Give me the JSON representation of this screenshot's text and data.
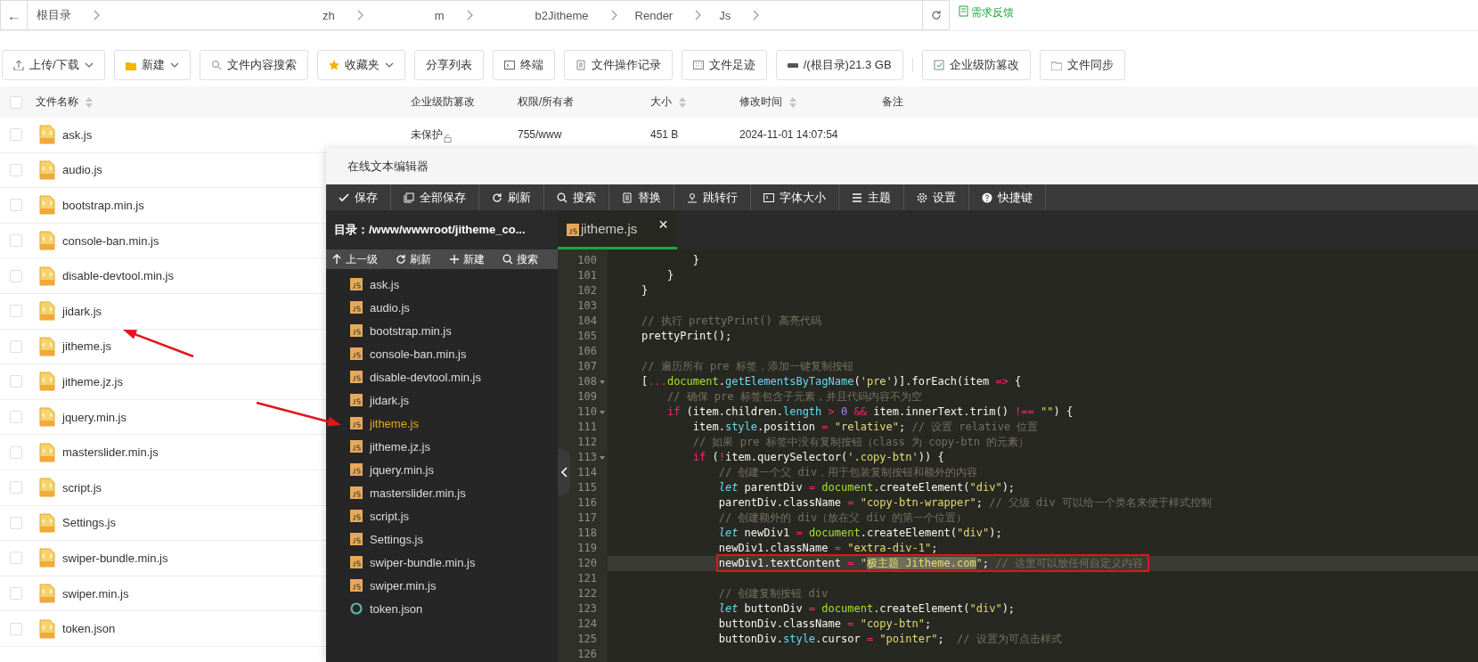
{
  "address_bar": {
    "back": "←",
    "segments": [
      "根目录",
      "zh",
      "m",
      "b2Jitheme",
      "Render",
      "Js"
    ],
    "feedback": "需求反馈"
  },
  "toolbar": [
    {
      "label": "上传/下载",
      "dropdown": true
    },
    {
      "label": "新建",
      "dropdown": true
    },
    {
      "label": "文件内容搜索",
      "dropdown": false
    },
    {
      "label": "收藏夹",
      "dropdown": true
    },
    {
      "label": "分享列表",
      "dropdown": false
    },
    {
      "label": "终端",
      "dropdown": false
    },
    {
      "label": "文件操作记录",
      "dropdown": false
    },
    {
      "label": "文件足迹",
      "dropdown": false
    },
    {
      "label": "/(根目录)21.3 GB",
      "dropdown": false
    },
    {
      "label": "企业级防篡改",
      "dropdown": false
    },
    {
      "label": "文件同步",
      "dropdown": false
    }
  ],
  "table": {
    "all_checked": false,
    "columns": [
      {
        "label": "文件名称",
        "sortable": true
      },
      {
        "label": "企业级防篡改",
        "sortable": false
      },
      {
        "label": "权限/所有者",
        "sortable": false
      },
      {
        "label": "大小",
        "sortable": true
      },
      {
        "label": "修改时间",
        "sortable": true
      },
      {
        "label": "备注",
        "sortable": false
      }
    ],
    "rows": [
      {
        "name": "ask.js",
        "checked": false,
        "protection": "未保护",
        "permission": "755/www",
        "size": "451 B",
        "modified": "2024-11-01 14:07:54"
      },
      {
        "name": "audio.js",
        "checked": false
      },
      {
        "name": "bootstrap.min.js",
        "checked": false
      },
      {
        "name": "console-ban.min.js",
        "checked": false
      },
      {
        "name": "disable-devtool.min.js",
        "checked": false
      },
      {
        "name": "jidark.js",
        "checked": false
      },
      {
        "name": "jitheme.js",
        "checked": false
      },
      {
        "name": "jitheme.jz.js",
        "checked": false
      },
      {
        "name": "jquery.min.js",
        "checked": false
      },
      {
        "name": "masterslider.min.js",
        "checked": false
      },
      {
        "name": "script.js",
        "checked": false
      },
      {
        "name": "Settings.js",
        "checked": false
      },
      {
        "name": "swiper-bundle.min.js",
        "checked": false
      },
      {
        "name": "swiper.min.js",
        "checked": false
      },
      {
        "name": "token.json",
        "checked": false
      }
    ]
  },
  "editor": {
    "title": "在线文本编辑器",
    "toolbar": [
      "保存",
      "全部保存",
      "刷新",
      "搜索",
      "替换",
      "跳转行",
      "字体大小",
      "主题",
      "设置",
      "快捷键"
    ],
    "directory": "目录：/www/wwwroot/jitheme_co...",
    "file_actions": [
      "上一级",
      "刷新",
      "新建",
      "搜索"
    ],
    "files": [
      {
        "name": "ask.js",
        "kind": "script",
        "selected": false
      },
      {
        "name": "audio.js",
        "kind": "script",
        "selected": false
      },
      {
        "name": "bootstrap.min.js",
        "kind": "script",
        "selected": false
      },
      {
        "name": "console-ban.min.js",
        "kind": "script",
        "selected": false
      },
      {
        "name": "disable-devtool.min.js",
        "kind": "script",
        "selected": false
      },
      {
        "name": "jidark.js",
        "kind": "script",
        "selected": false
      },
      {
        "name": "jitheme.js",
        "kind": "script",
        "selected": true
      },
      {
        "name": "jitheme.jz.js",
        "kind": "script",
        "selected": false
      },
      {
        "name": "jquery.min.js",
        "kind": "script",
        "selected": false
      },
      {
        "name": "masterslider.min.js",
        "kind": "script",
        "selected": false
      },
      {
        "name": "script.js",
        "kind": "script",
        "selected": false
      },
      {
        "name": "Settings.js",
        "kind": "script",
        "selected": false
      },
      {
        "name": "swiper-bundle.min.js",
        "kind": "script",
        "selected": false
      },
      {
        "name": "swiper.min.js",
        "kind": "script",
        "selected": false
      },
      {
        "name": "token.json",
        "kind": "data",
        "selected": false
      }
    ],
    "tabs": [
      {
        "label": "jitheme.js",
        "close": "×",
        "selected": true
      }
    ],
    "lines": [
      {
        "num": "100",
        "fold": false,
        "current": false,
        "boxed": false,
        "text": "        }"
      },
      {
        "num": "101",
        "fold": false,
        "current": false,
        "boxed": false,
        "text": "    }"
      },
      {
        "num": "102",
        "fold": false,
        "current": false,
        "boxed": false,
        "text": "}"
      },
      {
        "num": "103",
        "fold": false,
        "current": false,
        "boxed": false
      },
      {
        "num": "104",
        "fold": false,
        "current": false,
        "boxed": false,
        "text": "// 执行 prettyPrint() 高亮代码"
      },
      {
        "num": "105",
        "fold": false,
        "current": false,
        "boxed": false,
        "text": "prettyPrint();"
      },
      {
        "num": "106",
        "fold": false,
        "current": false,
        "boxed": false
      },
      {
        "num": "107",
        "fold": false,
        "current": false,
        "boxed": false,
        "text": "// 遍历所有 pre 标签，添加一键复制按钮"
      },
      {
        "num": "108",
        "fold": true,
        "current": false,
        "boxed": false,
        "text": "[...document.getElementsByTagName('pre')].forEach(item => {"
      },
      {
        "num": "109",
        "fold": false,
        "current": false,
        "boxed": false,
        "text": "    // 确保 pre 标签包含子元素，并且代码内容不为空"
      },
      {
        "num": "110",
        "fold": true,
        "current": false,
        "boxed": false,
        "text": "    if (item.children.length > 0 && item.innerText.trim() !== \"\") {"
      },
      {
        "num": "111",
        "fold": false,
        "current": false,
        "boxed": false,
        "text": "        item.style.position = \"relative\"; // 设置 relative 位置"
      },
      {
        "num": "112",
        "fold": false,
        "current": false,
        "boxed": false,
        "text": "        // 如果 pre 标签中没有复制按钮（class 为 copy-btn 的元素）"
      },
      {
        "num": "113",
        "fold": true,
        "current": false,
        "boxed": false,
        "text": "        if (!item.querySelector('.copy-btn')) {"
      },
      {
        "num": "114",
        "fold": false,
        "current": false,
        "boxed": false,
        "text": "            // 创建一个父 div，用于包装复制按钮和额外的内容"
      },
      {
        "num": "115",
        "fold": false,
        "current": false,
        "boxed": false,
        "text": "            let parentDiv = document.createElement(\"div\");"
      },
      {
        "num": "116",
        "fold": false,
        "current": false,
        "boxed": false,
        "text": "            parentDiv.className = \"copy-btn-wrapper\"; // 父级 div 可以给一个类名来便于样式控制"
      },
      {
        "num": "117",
        "fold": false,
        "current": false,
        "boxed": false,
        "text": "            // 创建额外的 div（放在父 div 的第一个位置）"
      },
      {
        "num": "118",
        "fold": false,
        "current": false,
        "boxed": false,
        "text": "            let newDiv1 = document.createElement(\"div\");"
      },
      {
        "num": "119",
        "fold": false,
        "current": false,
        "boxed": false,
        "text": "            newDiv1.className = \"extra-div-1\";"
      },
      {
        "num": "120",
        "fold": false,
        "current": true,
        "boxed": true,
        "string_selected": true,
        "text": "            newDiv1.textContent = \"极主题 Jitheme.com\"; // 这里可以放任何自定义内容"
      },
      {
        "num": "121",
        "fold": false,
        "current": false,
        "boxed": false
      },
      {
        "num": "122",
        "fold": false,
        "current": false,
        "boxed": false,
        "text": "            // 创建复制按钮 div"
      },
      {
        "num": "123",
        "fold": false,
        "current": false,
        "boxed": false,
        "text": "            let buttonDiv = document.createElement(\"div\");"
      },
      {
        "num": "124",
        "fold": false,
        "current": false,
        "boxed": false,
        "text": "            buttonDiv.className = \"copy-btn\";"
      },
      {
        "num": "125",
        "fold": false,
        "current": false,
        "boxed": false,
        "text": "            buttonDiv.style.cursor = \"pointer\";  // 设置为可点击样式"
      },
      {
        "num": "126",
        "fold": false,
        "current": false,
        "boxed": false
      }
    ]
  }
}
